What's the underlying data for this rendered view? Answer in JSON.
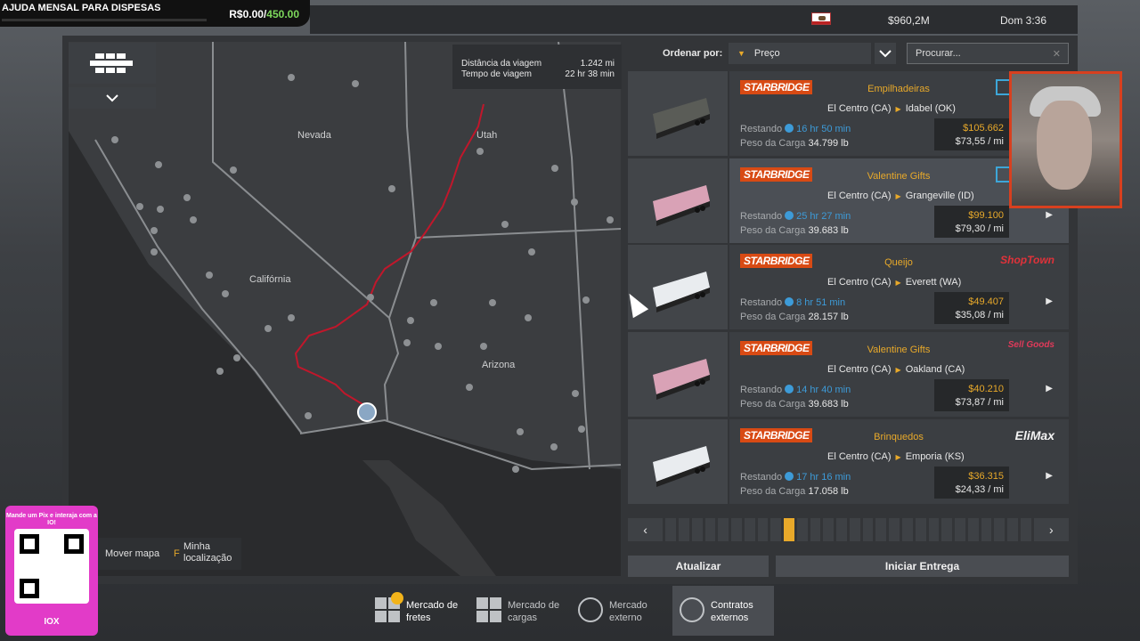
{
  "donation": {
    "label": "AJUDA MENSAL PARA DISPESAS",
    "current": "R$0.00",
    "goal": "450.00"
  },
  "status": {
    "money": "$960,2M",
    "time": "Dom 3:36"
  },
  "map": {
    "info": {
      "distance_label": "Distância da viagem",
      "distance_value": "1.242 mi",
      "time_label": "Tempo de viagem",
      "time_value": "22 hr 38 min"
    },
    "labels": {
      "nevada": "Nevada",
      "utah": "Utah",
      "california": "Califórnia",
      "arizona": "Arizona"
    },
    "help": {
      "move": "Mover mapa",
      "key": "F",
      "location": "Minha localização"
    }
  },
  "sort": {
    "label": "Ordenar por:",
    "value": "Preço"
  },
  "search": {
    "placeholder": "Procurar..."
  },
  "jobs": [
    {
      "company": "STARBRIDGE",
      "cargo": "Empilhadeiras",
      "from": "El Centro (CA)",
      "to": "Idabel (OK)",
      "rem_label": "Restando",
      "remaining": "16 hr 50 min",
      "weight_label": "Peso da Carga",
      "weight": "34.799 lb",
      "price": "$105.662",
      "rate": "$73,55 / mi",
      "logo": ""
    },
    {
      "company": "STARBRIDGE",
      "cargo": "Valentine Gifts",
      "from": "El Centro (CA)",
      "to": "Grangeville (ID)",
      "rem_label": "Restando",
      "remaining": "25 hr 27 min",
      "weight_label": "Peso da Carga",
      "weight": "39.683 lb",
      "price": "$99.100",
      "rate": "$79,30 / mi",
      "logo": ""
    },
    {
      "company": "STARBRIDGE",
      "cargo": "Queijo",
      "from": "El Centro (CA)",
      "to": "Everett (WA)",
      "rem_label": "Restando",
      "remaining": "8 hr 51 min",
      "weight_label": "Peso da Carga",
      "weight": "28.157 lb",
      "price": "$49.407",
      "rate": "$35,08 / mi",
      "logo": "ShopTown"
    },
    {
      "company": "STARBRIDGE",
      "cargo": "Valentine Gifts",
      "from": "El Centro (CA)",
      "to": "Oakland (CA)",
      "rem_label": "Restando",
      "remaining": "14 hr 40 min",
      "weight_label": "Peso da Carga",
      "weight": "39.683 lb",
      "price": "$40.210",
      "rate": "$73,87 / mi",
      "logo": "Sell Goods"
    },
    {
      "company": "STARBRIDGE",
      "cargo": "Brinquedos",
      "from": "El Centro (CA)",
      "to": "Emporia (KS)",
      "rem_label": "Restando",
      "remaining": "17 hr 16 min",
      "weight_label": "Peso da Carga",
      "weight": "17.058 lb",
      "price": "$36.315",
      "rate": "$24,33 / mi",
      "logo": "EliMax"
    }
  ],
  "pager": {
    "prev": "‹",
    "next": "›"
  },
  "buttons": {
    "refresh": "Atualizar",
    "start": "Iniciar Entrega"
  },
  "tabs": [
    {
      "l1": "Mercado de",
      "l2": "fretes"
    },
    {
      "l1": "Mercado de",
      "l2": "cargas"
    },
    {
      "l1": "Mercado",
      "l2": "externo"
    },
    {
      "l1": "Contratos",
      "l2": "externos"
    }
  ],
  "qr": {
    "text": "Mande um Pix e interaja com a IO!",
    "brand": "IOX"
  }
}
